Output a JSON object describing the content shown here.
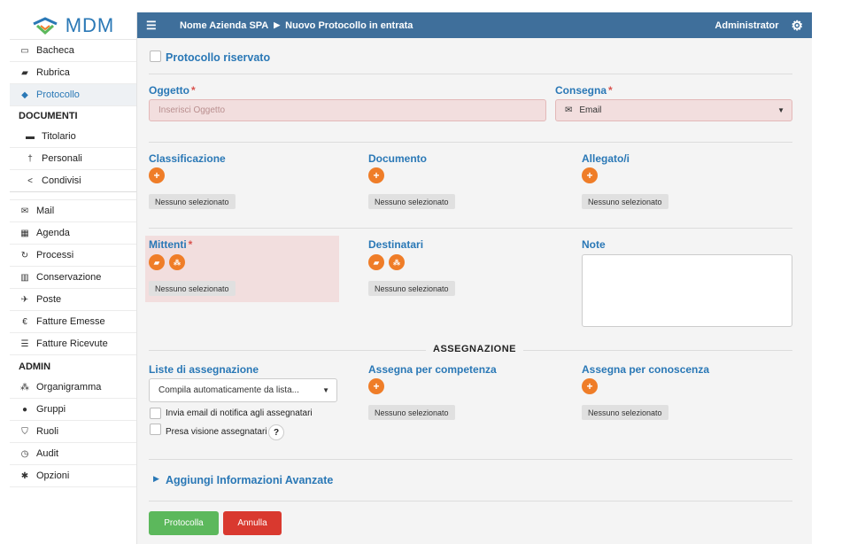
{
  "app": {
    "logo_text": "MDM"
  },
  "sidebar": {
    "items_top": [
      {
        "label": "Bacheca",
        "icon": "monitor-icon"
      },
      {
        "label": "Rubrica",
        "icon": "book-icon"
      },
      {
        "label": "Protocollo",
        "icon": "tag-icon",
        "active": true
      }
    ],
    "documenti_header": "DOCUMENTI",
    "items_documenti": [
      {
        "label": "Titolario",
        "icon": "archive-icon"
      },
      {
        "label": "Personali",
        "icon": "person-icon"
      },
      {
        "label": "Condivisi",
        "icon": "share-icon"
      }
    ],
    "items_mid": [
      {
        "label": "Mail",
        "icon": "envelope-icon"
      },
      {
        "label": "Agenda",
        "icon": "calendar-icon"
      },
      {
        "label": "Processi",
        "icon": "refresh-icon"
      },
      {
        "label": "Conservazione",
        "icon": "bank-icon"
      },
      {
        "label": "Poste",
        "icon": "plane-icon"
      },
      {
        "label": "Fatture Emesse",
        "icon": "euro-icon"
      },
      {
        "label": "Fatture Ricevute",
        "icon": "list-icon"
      }
    ],
    "admin_header": "ADMIN",
    "items_admin": [
      {
        "label": "Organigramma",
        "icon": "sitemap-icon"
      },
      {
        "label": "Gruppi",
        "icon": "users-icon"
      },
      {
        "label": "Ruoli",
        "icon": "shield-icon"
      },
      {
        "label": "Audit",
        "icon": "clock-icon"
      },
      {
        "label": "Opzioni",
        "icon": "gear-icon"
      }
    ]
  },
  "topbar": {
    "company": "Nome Azienda SPA",
    "page": "Nuovo Protocollo in entrata",
    "user": "Administrator"
  },
  "form": {
    "riservato_label": "Protocollo riservato",
    "oggetto_label": "Oggetto",
    "oggetto_placeholder": "Inserisci Oggetto",
    "consegna_label": "Consegna",
    "consegna_value": "Email",
    "classificazione_label": "Classificazione",
    "documento_label": "Documento",
    "allegato_label": "Allegato/i",
    "mittenti_label": "Mittenti",
    "destinatari_label": "Destinatari",
    "note_label": "Note",
    "none_selected": "Nessuno selezionato",
    "assegnazione_header": "ASSEGNAZIONE",
    "liste_label": "Liste di assegnazione",
    "liste_value": "Compila automaticamente da lista...",
    "competenza_label": "Assegna per competenza",
    "conoscenza_label": "Assegna per conoscenza",
    "invia_email_label": "Invia email di notifica agli assegnatari",
    "presa_visione_label": "Presa visione assegnatari",
    "help_symbol": "?",
    "avanzate_label": "Aggiungi Informazioni Avanzate",
    "protocolla_label": "Protocolla",
    "annulla_label": "Annulla",
    "required_mark": "*"
  },
  "colors": {
    "accent": "#2a78b6",
    "topbar": "#3f6f9b",
    "orange": "#ef7d28",
    "green": "#5cb85c",
    "red": "#d9392f"
  }
}
